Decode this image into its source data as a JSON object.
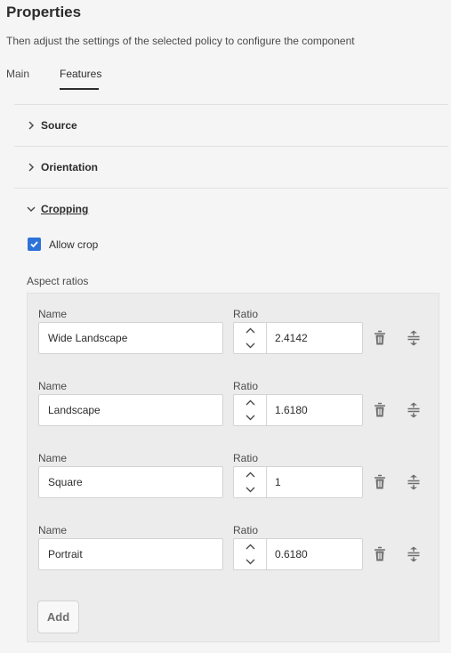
{
  "header": {
    "title": "Properties",
    "subtitle": "Then adjust the settings of the selected policy to configure the component"
  },
  "tabs": [
    {
      "label": "Main",
      "active": false
    },
    {
      "label": "Features",
      "active": true
    }
  ],
  "sections": [
    {
      "label": "Source",
      "expanded": false
    },
    {
      "label": "Orientation",
      "expanded": false
    },
    {
      "label": "Cropping",
      "expanded": true
    }
  ],
  "cropping": {
    "allow_crop": {
      "label": "Allow crop",
      "checked": true
    },
    "aspect_ratios_label": "Aspect ratios",
    "name_label": "Name",
    "ratio_label": "Ratio",
    "rows": [
      {
        "name": "Wide Landscape",
        "ratio": "2.4142"
      },
      {
        "name": "Landscape",
        "ratio": "1.6180"
      },
      {
        "name": "Square",
        "ratio": "1"
      },
      {
        "name": "Portrait",
        "ratio": "0.6180"
      }
    ],
    "add_label": "Add"
  },
  "colors": {
    "checkbox_accent": "#2d72d9",
    "text_primary": "#2c2c2c",
    "panel_bg": "#ececec"
  },
  "icons": {
    "section_collapsed": "chevron-right-icon",
    "section_expanded": "chevron-down-icon",
    "delete": "trash-icon",
    "reorder": "drag-handle-icon",
    "increment": "chevron-up-icon",
    "decrement": "chevron-down-icon"
  }
}
